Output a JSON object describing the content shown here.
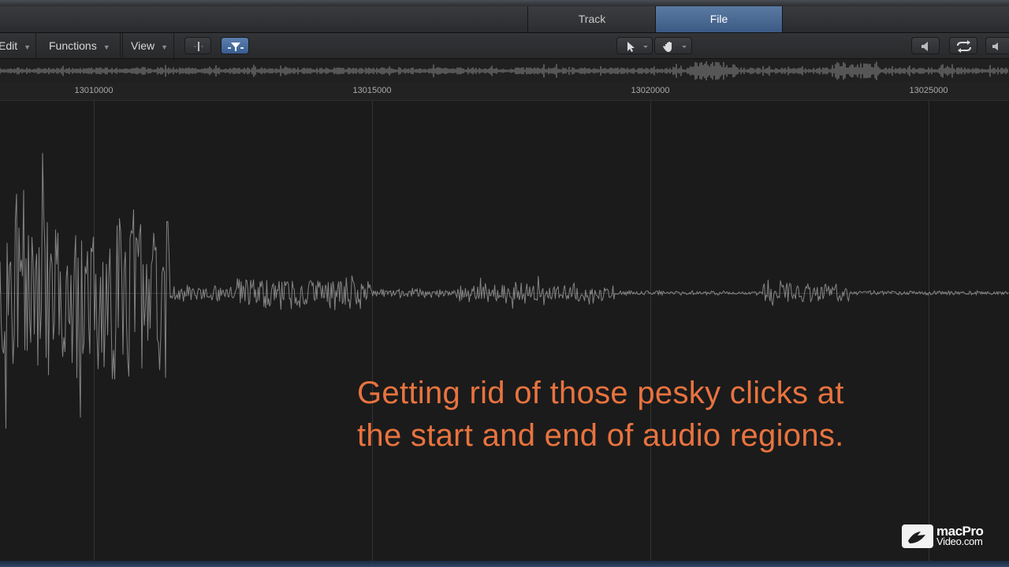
{
  "tabs": {
    "track": "Track",
    "file": "File",
    "selected": "File"
  },
  "toolbar": {
    "edit": "Edit",
    "functions": "Functions",
    "view": "View",
    "icons": [
      "insert-marker-icon",
      "catch-filter-icon",
      "pointer-tool-icon",
      "hand-tool-icon",
      "speaker-icon",
      "cycle-icon",
      "volume-icon"
    ]
  },
  "ruler": {
    "labels": [
      "13010000",
      "13015000",
      "13020000",
      "13025000"
    ]
  },
  "caption": {
    "line1": "Getting rid of those pesky clicks at",
    "line2": "the start and end of audio regions."
  },
  "logo": {
    "line1": "macPro",
    "line2": "Video.com"
  },
  "colors": {
    "accent": "#4f73a4",
    "caption": "#e8733f",
    "waveform": "#8a8a8a"
  }
}
